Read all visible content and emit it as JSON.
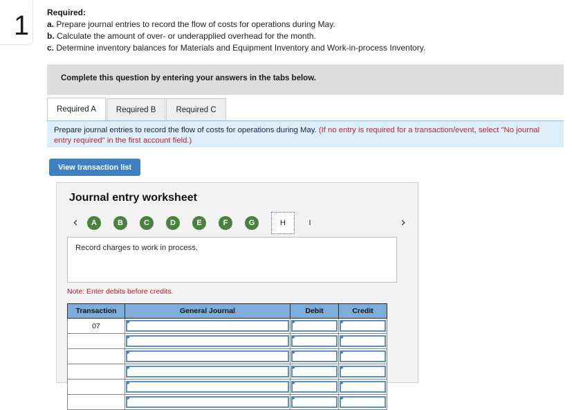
{
  "question": {
    "number": "1",
    "required_heading": "Required:",
    "items": [
      {
        "letter": "a.",
        "text": "Prepare journal entries to record the flow of costs for operations during May."
      },
      {
        "letter": "b.",
        "text": "Calculate the amount of over- or underapplied overhead for the month."
      },
      {
        "letter": "c.",
        "text": "Determine inventory balances for Materials and Equipment Inventory and Work-in-process Inventory."
      }
    ]
  },
  "gray_banner": {
    "text": "Complete this question by entering your answers in the tabs below."
  },
  "tabs": [
    {
      "label": "Required A",
      "active": true
    },
    {
      "label": "Required B",
      "active": false
    },
    {
      "label": "Required C",
      "active": false
    }
  ],
  "instruction_bar": {
    "main": "Prepare journal entries to record the flow of costs for operations during May.",
    "parenthetical": "(If no entry is required for a transaction/event, select \"No journal entry required\" in the first account field.)"
  },
  "toolbar": {
    "view_transaction_list_label": "View transaction list"
  },
  "worksheet": {
    "title": "Journal entry worksheet",
    "pager": {
      "prev_icon": "chevron-left-icon",
      "next_icon": "chevron-right-icon",
      "pages": [
        {
          "label": "A",
          "state": "done"
        },
        {
          "label": "B",
          "state": "done"
        },
        {
          "label": "C",
          "state": "done"
        },
        {
          "label": "D",
          "state": "done"
        },
        {
          "label": "E",
          "state": "done"
        },
        {
          "label": "F",
          "state": "done"
        },
        {
          "label": "G",
          "state": "done"
        },
        {
          "label": "H",
          "state": "selected"
        },
        {
          "label": "I",
          "state": "plain"
        }
      ]
    },
    "description": "Record charges to work in process.",
    "note": "Note: Enter debits before credits.",
    "table": {
      "headers": [
        "Transaction",
        "General Journal",
        "Debit",
        "Credit"
      ],
      "rows": [
        {
          "transaction": "07",
          "general_journal": "",
          "debit": "",
          "credit": ""
        },
        {
          "transaction": "",
          "general_journal": "",
          "debit": "",
          "credit": ""
        },
        {
          "transaction": "",
          "general_journal": "",
          "debit": "",
          "credit": ""
        },
        {
          "transaction": "",
          "general_journal": "",
          "debit": "",
          "credit": ""
        },
        {
          "transaction": "",
          "general_journal": "",
          "debit": "",
          "credit": ""
        },
        {
          "transaction": "",
          "general_journal": "",
          "debit": "",
          "credit": ""
        }
      ]
    }
  },
  "colors": {
    "accent_blue": "#3f80c2",
    "table_header_blue": "#7eaddb",
    "instruction_bar_blue": "#ddeefb",
    "pager_green": "#4a813f",
    "alert_red": "#b02030",
    "banner_gray": "#dddddd"
  }
}
